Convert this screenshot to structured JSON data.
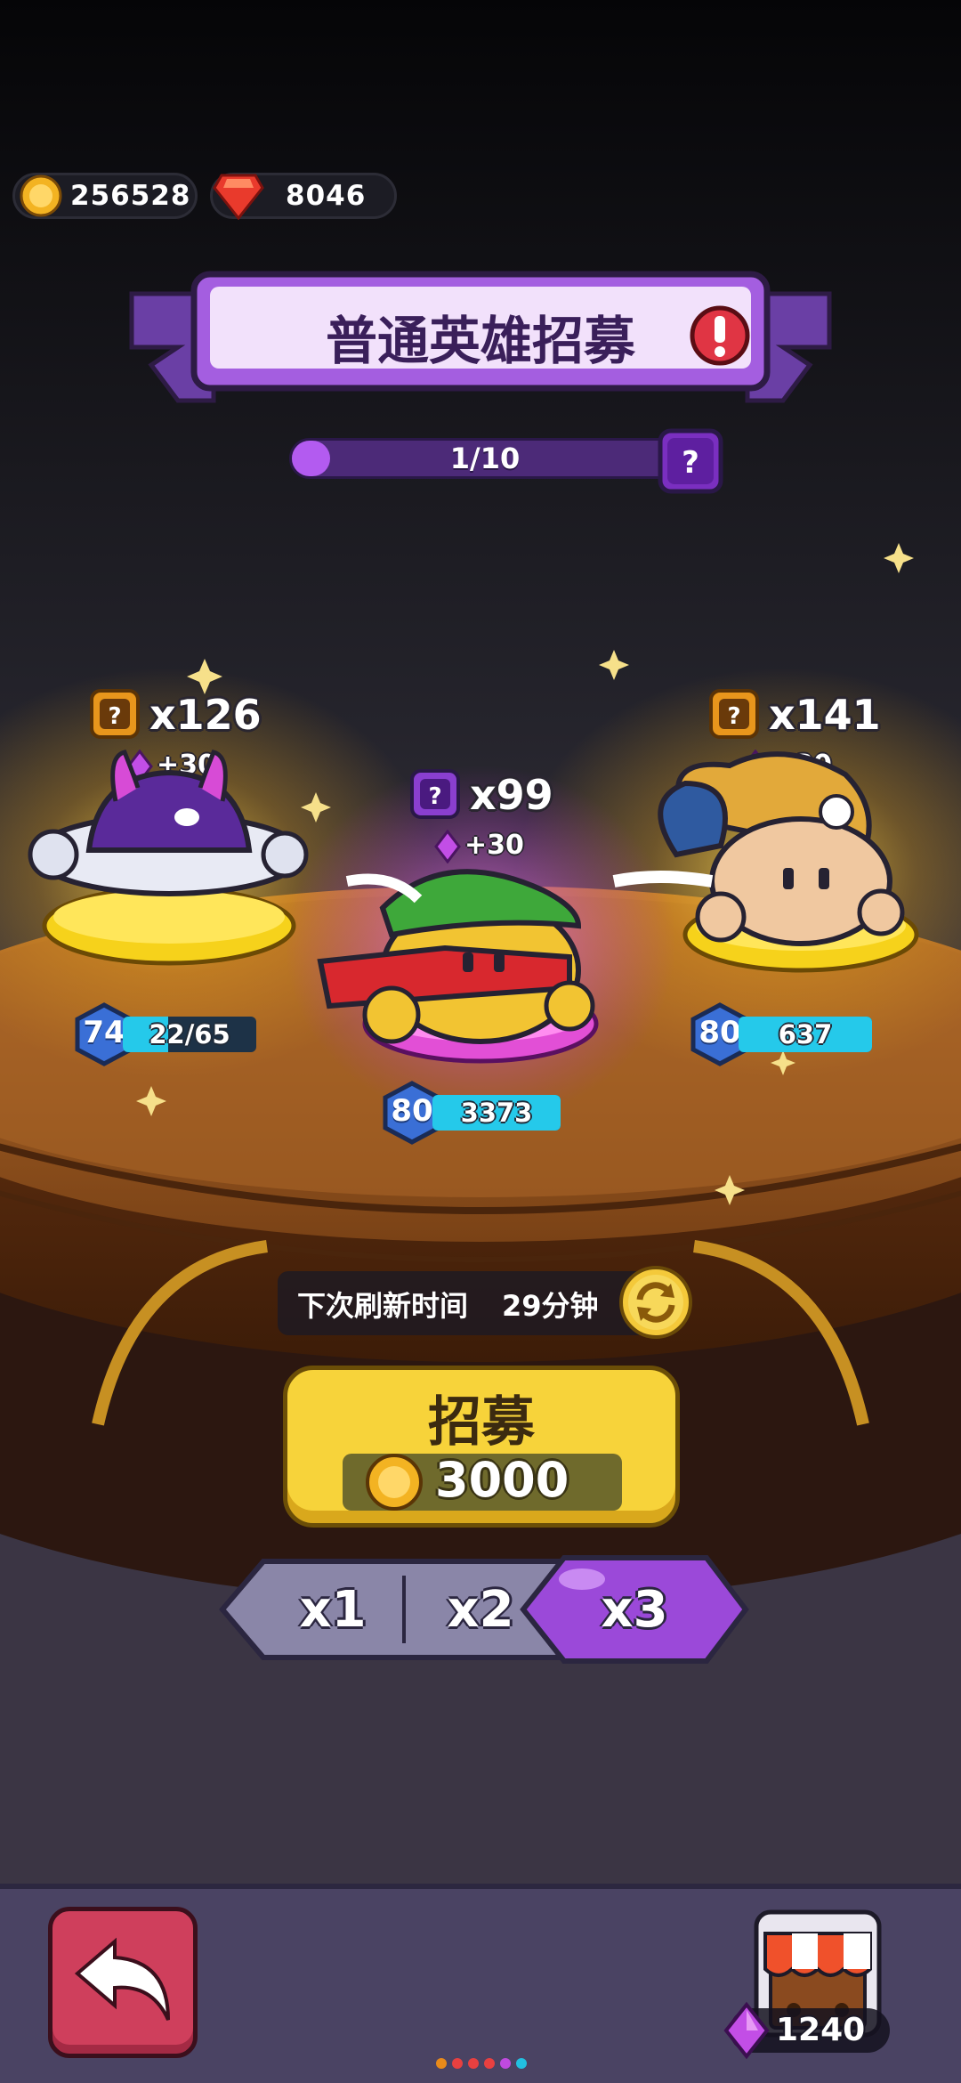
{
  "currencies": {
    "coins": "256528",
    "rubies": "8046"
  },
  "banner": {
    "title": "普通英雄招募",
    "alert_icon": "exclamation-icon"
  },
  "progress": {
    "text": "1/10",
    "current": 1,
    "total": 10,
    "help_icon": "question-icon"
  },
  "heroes": [
    {
      "name_icon": "question-box-icon",
      "count": "x126",
      "bonus": "+30",
      "level": "74",
      "shards": "22/65",
      "shard_fill": 0.34,
      "plate_color": "#f6d21b"
    },
    {
      "name_icon": "question-box-icon",
      "count": "x99",
      "bonus": "+30",
      "level": "80",
      "shards": "3373",
      "shard_fill": 1.0,
      "plate_color": "#e24fd6"
    },
    {
      "name_icon": "question-box-icon",
      "count": "x141",
      "bonus": "+30",
      "level": "80",
      "shards": "637",
      "shard_fill": 1.0,
      "plate_color": "#f6d21b"
    }
  ],
  "refresh": {
    "label": "下次刷新时间",
    "time": "29分钟",
    "button_icon": "refresh-icon"
  },
  "recruit": {
    "label": "招募",
    "cost": "3000",
    "cost_icon": "coin-icon"
  },
  "multipliers": {
    "options": [
      "x1",
      "x2",
      "x3"
    ],
    "selected": "x3"
  },
  "footer": {
    "back_icon": "back-arrow-icon",
    "shop_icon": "shop-stall-icon",
    "gems": "1240",
    "gem_icon": "purple-gem-icon"
  },
  "colors": {
    "accent_purple": "#9b49d9",
    "gold": "#f7d33a",
    "back_button": "#cf3f5c",
    "footer_bg": "#4a4363"
  }
}
